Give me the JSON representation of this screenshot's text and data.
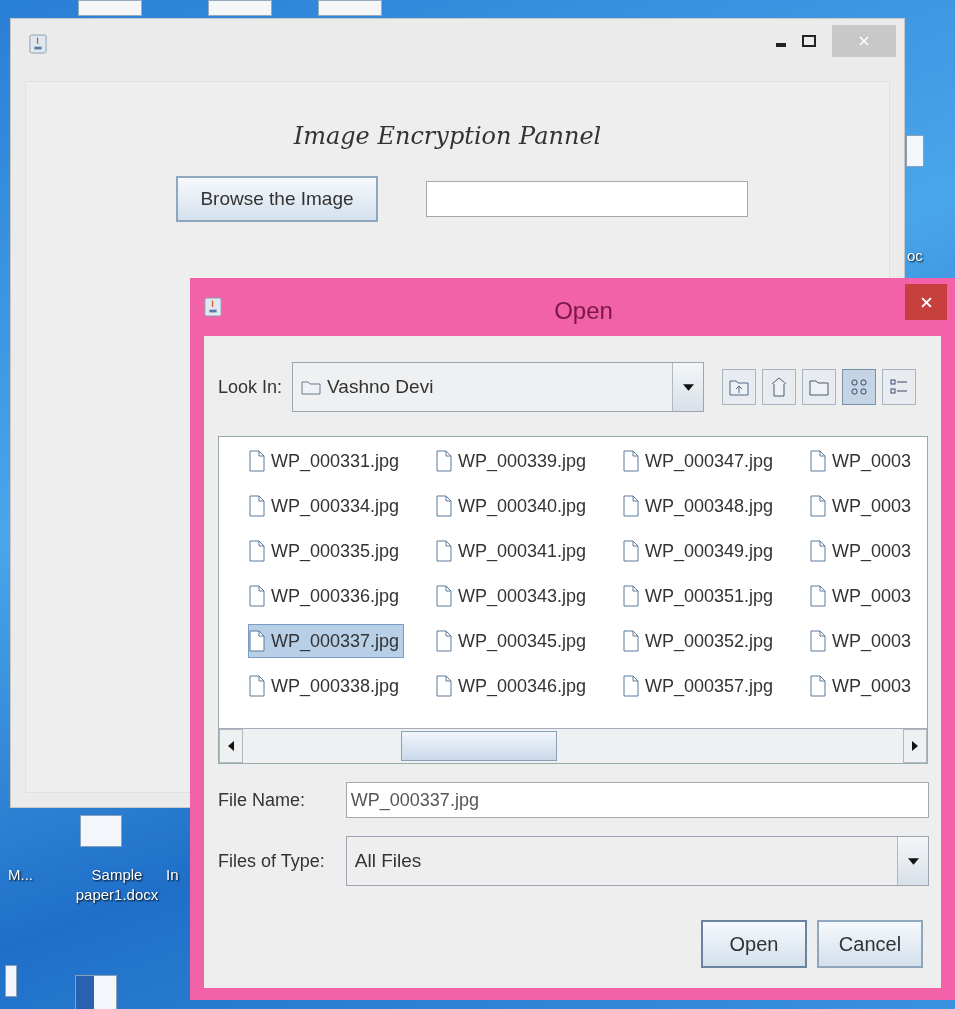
{
  "desktop": {
    "icons": [
      {
        "label": "M..."
      },
      {
        "label": "Sample paper1.docx"
      },
      {
        "label": "In"
      },
      {
        "label": "oc"
      }
    ]
  },
  "main_window": {
    "heading": "Image Encryption Pannel",
    "browse_button": "Browse the Image"
  },
  "dialog": {
    "title": "Open",
    "look_in": {
      "label": "Look In:",
      "value": "Vashno Devi"
    },
    "toolbar": [
      {
        "kind": "up",
        "selected": false
      },
      {
        "kind": "home",
        "selected": false
      },
      {
        "kind": "new_folder",
        "selected": false
      },
      {
        "kind": "list",
        "selected": true
      },
      {
        "kind": "details",
        "selected": false
      }
    ],
    "files": [
      [
        {
          "name": "WP_000331.jpg",
          "selected": false
        },
        {
          "name": "WP_000334.jpg",
          "selected": false
        },
        {
          "name": "WP_000335.jpg",
          "selected": false
        },
        {
          "name": "WP_000336.jpg",
          "selected": false
        },
        {
          "name": "WP_000337.jpg",
          "selected": true
        },
        {
          "name": "WP_000338.jpg",
          "selected": false
        }
      ],
      [
        {
          "name": "WP_000339.jpg",
          "selected": false
        },
        {
          "name": "WP_000340.jpg",
          "selected": false
        },
        {
          "name": "WP_000341.jpg",
          "selected": false
        },
        {
          "name": "WP_000343.jpg",
          "selected": false
        },
        {
          "name": "WP_000345.jpg",
          "selected": false
        },
        {
          "name": "WP_000346.jpg",
          "selected": false
        }
      ],
      [
        {
          "name": "WP_000347.jpg",
          "selected": false
        },
        {
          "name": "WP_000348.jpg",
          "selected": false
        },
        {
          "name": "WP_000349.jpg",
          "selected": false
        },
        {
          "name": "WP_000351.jpg",
          "selected": false
        },
        {
          "name": "WP_000352.jpg",
          "selected": false
        },
        {
          "name": "WP_000357.jpg",
          "selected": false
        }
      ],
      [
        {
          "name": "WP_0003",
          "selected": false
        },
        {
          "name": "WP_0003",
          "selected": false
        },
        {
          "name": "WP_0003",
          "selected": false
        },
        {
          "name": "WP_0003",
          "selected": false
        },
        {
          "name": "WP_0003",
          "selected": false
        },
        {
          "name": "WP_0003",
          "selected": false
        }
      ]
    ],
    "file_name": {
      "label": "File Name:",
      "value": "WP_000337.jpg"
    },
    "file_type": {
      "label": "Files of Type:",
      "value": "All Files"
    },
    "buttons": [
      "Open",
      "Cancel"
    ]
  }
}
